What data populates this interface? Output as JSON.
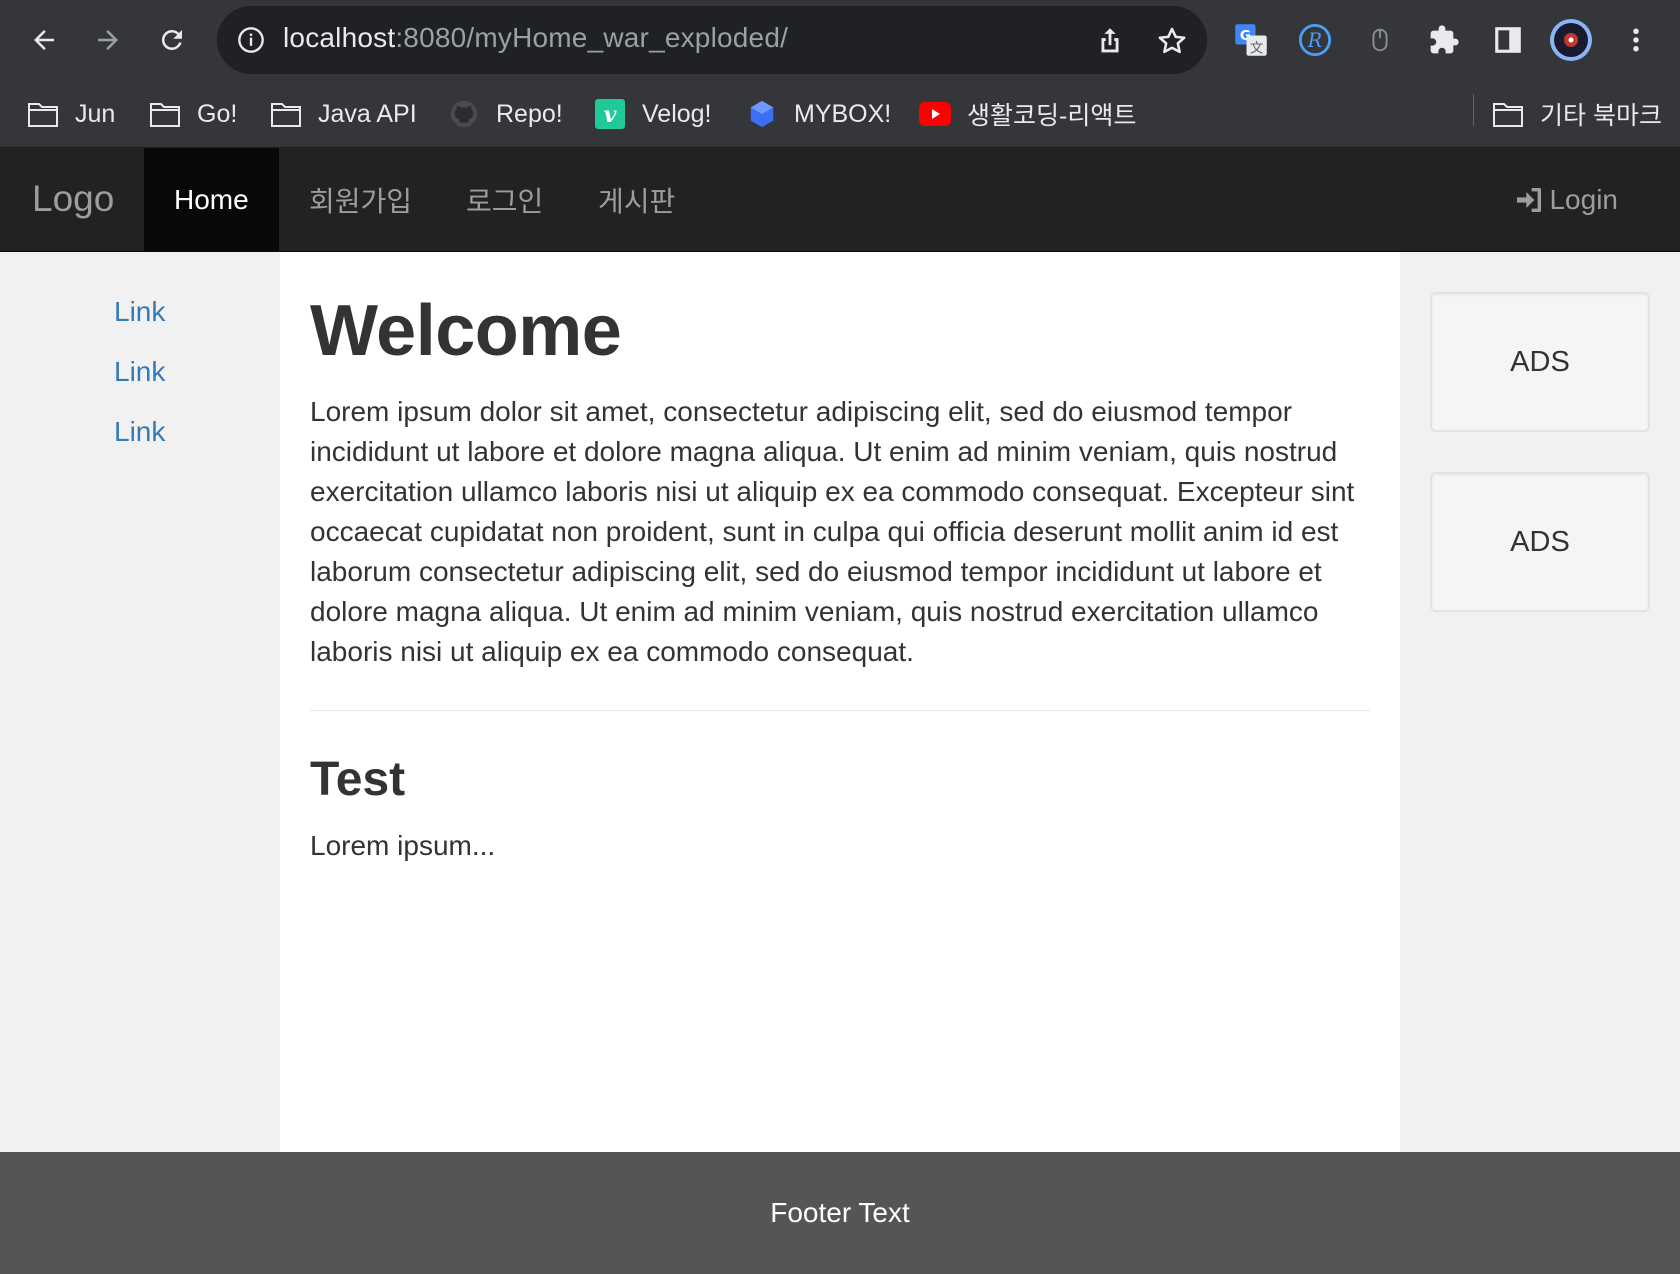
{
  "browser": {
    "url_host": "localhost",
    "url_path": ":8080/myHome_war_exploded/",
    "bookmarks": [
      {
        "label": "Jun",
        "icon": "folder-icon"
      },
      {
        "label": "Go!",
        "icon": "folder-icon"
      },
      {
        "label": "Java API",
        "icon": "folder-icon"
      },
      {
        "label": "Repo!",
        "icon": "github-icon"
      },
      {
        "label": "Velog!",
        "icon": "velog-icon"
      },
      {
        "label": "MYBOX!",
        "icon": "mybox-icon"
      },
      {
        "label": "생활코딩-리액트",
        "icon": "youtube-icon"
      }
    ],
    "other_bookmarks": "기타 북마크"
  },
  "navbar": {
    "logo": "Logo",
    "items": [
      {
        "label": "Home"
      },
      {
        "label": "회원가입"
      },
      {
        "label": "로그인"
      },
      {
        "label": "게시판"
      }
    ],
    "login": "Login"
  },
  "sidebar_left": {
    "links": [
      "Link",
      "Link",
      "Link"
    ]
  },
  "main": {
    "title": "Welcome",
    "paragraph": "Lorem ipsum dolor sit amet, consectetur adipiscing elit, sed do eiusmod tempor incididunt ut labore et dolore magna aliqua. Ut enim ad minim veniam, quis nostrud exercitation ullamco laboris nisi ut aliquip ex ea commodo consequat. Excepteur sint occaecat cupidatat non proident, sunt in culpa qui officia deserunt mollit anim id est laborum consectetur adipiscing elit, sed do eiusmod tempor incididunt ut labore et dolore magna aliqua. Ut enim ad minim veniam, quis nostrud exercitation ullamco laboris nisi ut aliquip ex ea commodo consequat.",
    "subtitle": "Test",
    "sub_paragraph": "Lorem ipsum..."
  },
  "sidebar_right": {
    "ads": [
      "ADS",
      "ADS"
    ]
  },
  "footer": {
    "text": "Footer Text"
  },
  "colors": {
    "navbar_bg": "#222222",
    "link": "#337ab7",
    "footer_bg": "#555555",
    "sidebar_bg": "#f1f1f1"
  }
}
